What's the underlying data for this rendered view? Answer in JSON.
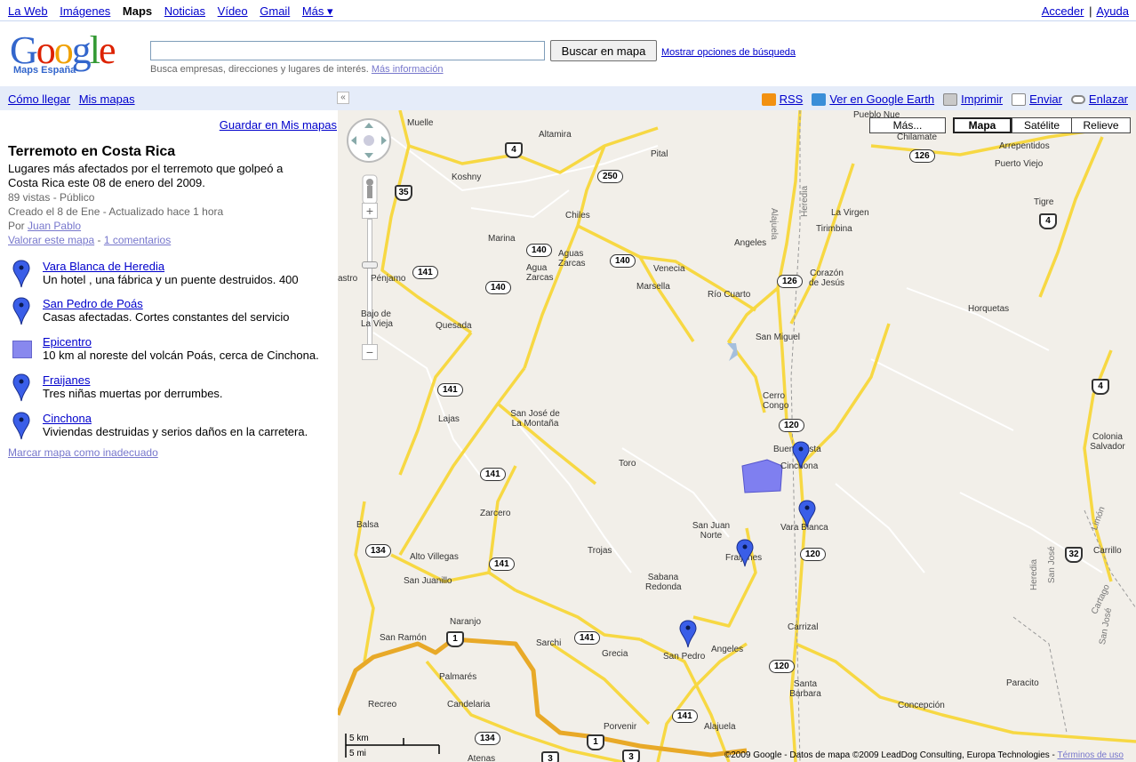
{
  "topnav": {
    "items": [
      "La Web",
      "Imágenes",
      "Maps",
      "Noticias",
      "Vídeo",
      "Gmail",
      "Más ▾"
    ],
    "sign_in": "Acceder",
    "help": "Ayuda",
    "separator": "|"
  },
  "header": {
    "logo_text": "Google",
    "logo_sub": "Maps España",
    "search_value": "",
    "search_button": "Buscar en mapa",
    "options_link": "Mostrar opciones de búsqueda",
    "hint": "Busca empresas, direcciones y lugares de interés.",
    "hint_link": "Más información"
  },
  "bar": {
    "directions": "Cómo llegar",
    "my_maps": "Mis mapas",
    "collapse": "«",
    "rss": "RSS",
    "earth": "Ver en Google Earth",
    "print": "Imprimir",
    "send": "Enviar",
    "link": "Enlazar"
  },
  "sidebar": {
    "save": "Guardar en Mis mapas",
    "title": "Terremoto en Costa Rica",
    "description": "Lugares más afectados por el terremoto que golpeó a Costa Rica este 08 de enero del 2009.",
    "views": "89 vistas - Público",
    "created": "Creado el 8 de Ene - Actualizado hace 1 hora",
    "by_prefix": "Por",
    "author": "Juan Pablo",
    "rate": "Valorar este mapa",
    "dash": "-",
    "comments": "1 comentarios",
    "places": [
      {
        "name": "Vara Blanca de Heredia",
        "desc": "Un hotel , una fábrica y un puente destruidos. 400",
        "icon": "pin"
      },
      {
        "name": "San Pedro de Poás",
        "desc": "Casas afectadas. Cortes constantes del servicio",
        "icon": "pin"
      },
      {
        "name": "Epicentro",
        "desc": "10 km al noreste del volcán Poás, cerca de Cinchona.",
        "icon": "polygon"
      },
      {
        "name": "Fraijanes",
        "desc": "Tres niñas muertas por derrumbes.",
        "icon": "pin"
      },
      {
        "name": "Cinchona",
        "desc": "Viviendas destruidas y serios daños en la carretera.",
        "icon": "pin"
      }
    ],
    "flag": "Marcar mapa como inadecuado"
  },
  "map": {
    "types": {
      "more": "Más...",
      "map": "Mapa",
      "satellite": "Satélite",
      "terrain": "Relieve"
    },
    "zoom_in": "+",
    "zoom_out": "−",
    "labels": [
      "Muelle",
      "Altamira",
      "Pital",
      "Koshny",
      "Chiles",
      "Aguas Zarcas",
      "Agua Zarcas",
      "Marina",
      "Venecia",
      "Marsella",
      "Río Cuarto",
      "Angeles",
      "Pénjamo",
      "Quesada",
      "San Miguel",
      "Cerro Congo",
      "Lajas",
      "San José de La Montaña",
      "Toro",
      "Buena Vista",
      "Cinchona",
      "Vara Blanca",
      "San Juan Norte",
      "Fraijanes",
      "Trojas",
      "Zarcero",
      "Balsa",
      "Alto Villegas",
      "San Juanillo",
      "Sabana Redonda",
      "Naranjo",
      "San Ramón",
      "Sarchi",
      "Grecia",
      "San Pedro",
      "Angeles",
      "Carrizal",
      "Palmarés",
      "Recreo",
      "Candelaria",
      "Porvenir",
      "Alajuela",
      "Santa Barbara",
      "Concepción",
      "Paracito",
      "Colonia Salvador",
      "Horquetas",
      "Corazón de Jesús",
      "Tirimbina",
      "La Virgen",
      "Chilamate",
      "Arrepentidos",
      "Puerto Viejo",
      "Tigre",
      "Carrillo",
      "Atenas",
      "Bajo de La Vieja",
      "Pueblo Nue",
      "astro"
    ],
    "roads": [
      "4",
      "35",
      "250",
      "140",
      "140",
      "140",
      "141",
      "141",
      "141",
      "141",
      "141",
      "141",
      "126",
      "126",
      "120",
      "120",
      "120",
      "134",
      "134",
      "4",
      "4",
      "32",
      "1",
      "1",
      "3",
      "3"
    ],
    "scale_km": "5 km",
    "scale_mi": "5 mi",
    "copyright": "©2009 Google - Datos de mapa ©2009 LeadDog Consulting, Europa Technologies -",
    "terms": "Términos de uso",
    "road_names": [
      "Alajuela",
      "Heredia",
      "Heredia",
      "San José",
      "Cartago",
      "San José",
      "Limón"
    ]
  }
}
